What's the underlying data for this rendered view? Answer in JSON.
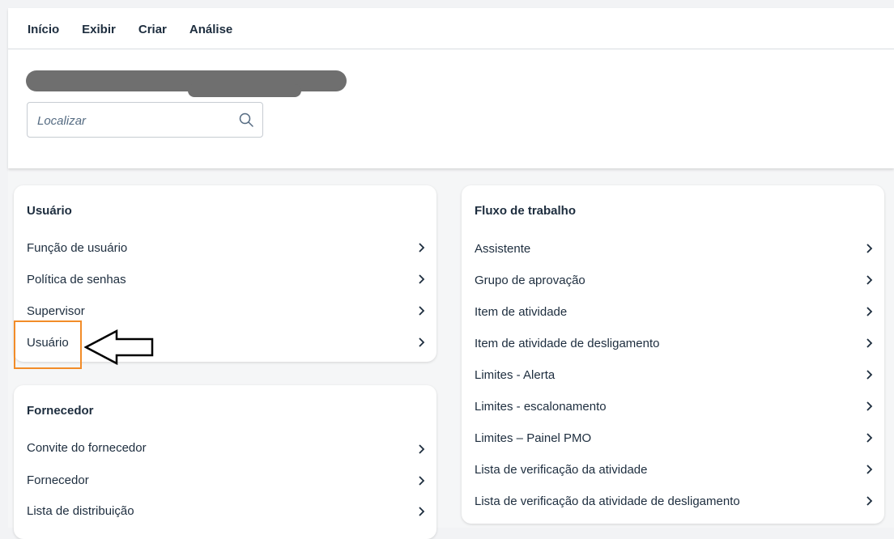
{
  "menu": {
    "items": [
      "Início",
      "Exibir",
      "Criar",
      "Análise"
    ]
  },
  "search": {
    "placeholder": "Localizar",
    "icon": "search-icon"
  },
  "cards": {
    "usuario": {
      "title": "Usuário",
      "items": [
        "Função de usuário",
        "Política de senhas",
        "Supervisor",
        "Usuário"
      ]
    },
    "fornecedor": {
      "title": "Fornecedor",
      "items": [
        "Convite do fornecedor",
        "Fornecedor",
        "Lista de distribuição"
      ]
    },
    "fluxo": {
      "title": "Fluxo de trabalho",
      "items": [
        "Assistente",
        "Grupo de aprovação",
        "Item de atividade",
        "Item de atividade de desligamento",
        "Limites - Alerta",
        "Limites - escalonamento",
        "Limites – Painel PMO",
        "Lista de verificação da atividade",
        "Lista de verificação da atividade de desligamento"
      ]
    }
  },
  "annotation": {
    "highlight_color": "#f28c28",
    "arrow_icon": "left-arrow-icon"
  }
}
